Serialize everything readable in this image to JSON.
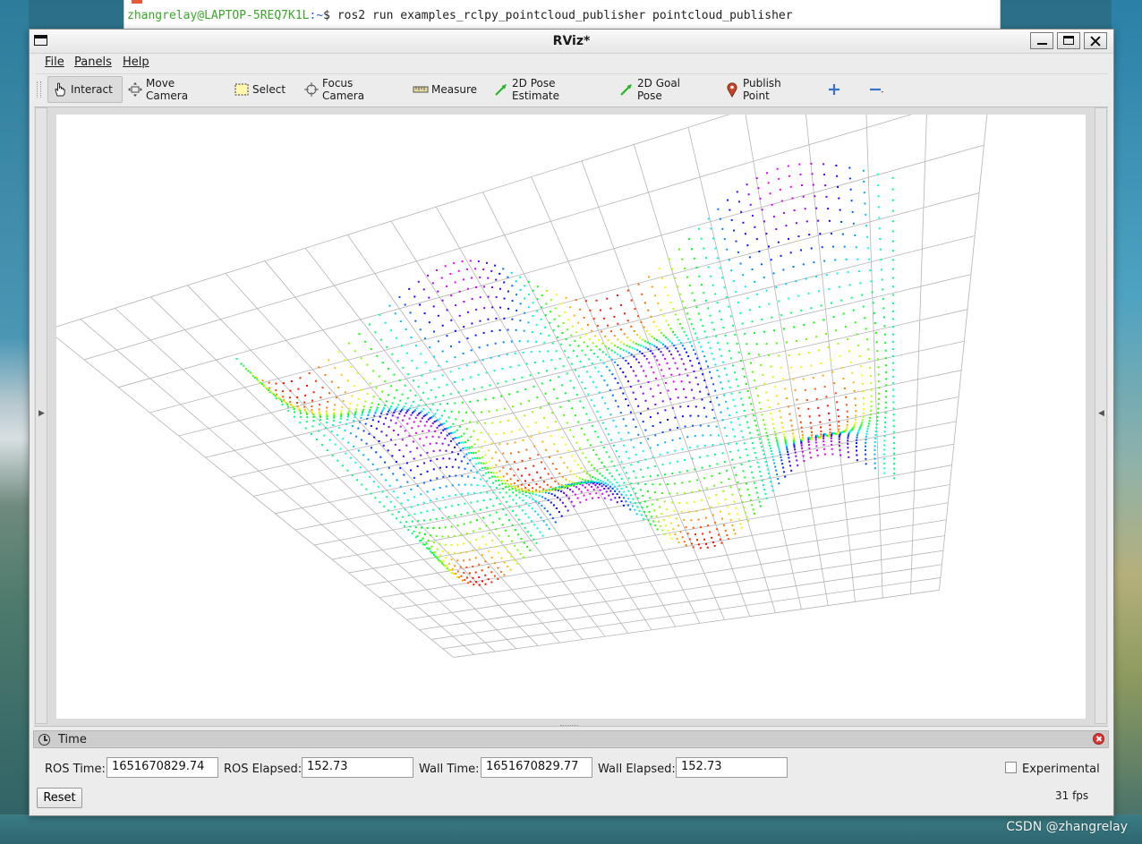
{
  "terminal": {
    "user_host": "zhangrelay@LAPTOP-5REQ7K1L",
    "path": ":~",
    "prompt_end": "$ ",
    "command": "ros2 run examples_rclpy_pointcloud_publisher pointcloud_publisher"
  },
  "window": {
    "title": "RViz*"
  },
  "menu": {
    "file": "File",
    "panels": "Panels",
    "help": "Help"
  },
  "toolbar": {
    "interact": "Interact",
    "move_camera": "Move Camera",
    "select": "Select",
    "focus_camera": "Focus Camera",
    "measure": "Measure",
    "pose_estimate": "2D Pose Estimate",
    "goal_pose": "2D Goal Pose",
    "publish_point": "Publish Point"
  },
  "time_panel": {
    "title": "Time",
    "ros_time_label": "ROS Time:",
    "ros_time_value": "1651670829.74",
    "ros_elapsed_label": "ROS Elapsed:",
    "ros_elapsed_value": "152.73",
    "wall_time_label": "Wall Time:",
    "wall_time_value": "1651670829.77",
    "wall_elapsed_label": "Wall Elapsed:",
    "wall_elapsed_value": "152.73",
    "experimental_label": "Experimental",
    "experimental_checked": false,
    "reset_label": "Reset",
    "fps": "31 fps"
  },
  "watermark": "CSDN @zhangrelay",
  "colors": {
    "viewport_bg": "#ffffff",
    "grid_line": "#b4b4b4",
    "pointcloud_colormap": [
      "#ff0000",
      "#ffff00",
      "#00ff00",
      "#00ffff",
      "#0000ff",
      "#ff00ff"
    ]
  }
}
